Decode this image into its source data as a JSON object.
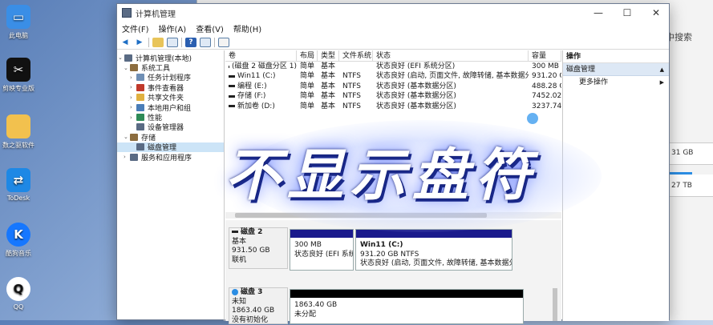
{
  "desktop": {
    "icons": [
      {
        "label": "此电脑",
        "icon": "monitor-icon",
        "color": "#3a8ee6"
      },
      {
        "label": "剪映专业版",
        "icon": "capcut-icon",
        "color": "#111111"
      },
      {
        "label": "数之驱软件",
        "icon": "folder-icon",
        "color": "#f2c14e"
      },
      {
        "label": "ToDesk",
        "icon": "todesk-icon",
        "color": "#1e88e5"
      },
      {
        "label": "酷狗音乐",
        "icon": "kugou-icon",
        "color": "#1677ff"
      },
      {
        "label": "QQ",
        "icon": "qq-icon",
        "color": "#ffffff"
      }
    ]
  },
  "back_window": {
    "search_text": "中搜索",
    "rows": [
      "31 GB",
      "27 TB"
    ]
  },
  "window": {
    "title": "计算机管理",
    "controls": {
      "minimize": "—",
      "maximize": "☐",
      "close": "✕"
    },
    "menu": [
      "文件(F)",
      "操作(A)",
      "查看(V)",
      "帮助(H)"
    ]
  },
  "tree": [
    {
      "label": "计算机管理(本地)",
      "level": 0,
      "chevron": "⌄",
      "icon_color": "#5a6b84"
    },
    {
      "label": "系统工具",
      "level": 1,
      "chevron": "⌄",
      "icon_color": "#8c6d3f"
    },
    {
      "label": "任务计划程序",
      "level": 2,
      "chevron": "›",
      "icon_color": "#6f8fb5"
    },
    {
      "label": "事件查看器",
      "level": 2,
      "chevron": "›",
      "icon_color": "#c0392b"
    },
    {
      "label": "共享文件夹",
      "level": 2,
      "chevron": "›",
      "icon_color": "#e0b040"
    },
    {
      "label": "本地用户和组",
      "level": 2,
      "chevron": "›",
      "icon_color": "#4a7db8"
    },
    {
      "label": "性能",
      "level": 2,
      "chevron": "›",
      "icon_color": "#2e8b57"
    },
    {
      "label": "设备管理器",
      "level": 2,
      "chevron": "",
      "icon_color": "#5a6b84"
    },
    {
      "label": "存储",
      "level": 1,
      "chevron": "⌄",
      "icon_color": "#8c6d3f"
    },
    {
      "label": "磁盘管理",
      "level": 2,
      "chevron": "",
      "icon_color": "#5a6b84",
      "selected": true
    },
    {
      "label": "服务和应用程序",
      "level": 1,
      "chevron": "›",
      "icon_color": "#5a6b84"
    }
  ],
  "volumes": {
    "headers": [
      "卷",
      "布局",
      "类型",
      "文件系统",
      "状态",
      "容量"
    ],
    "rows": [
      [
        "(磁盘 2 磁盘分区 1)",
        "简单",
        "基本",
        "",
        "状态良好 (EFI 系统分区)",
        "300 MB"
      ],
      [
        "Win11 (C:)",
        "简单",
        "基本",
        "NTFS",
        "状态良好 (启动, 页面文件, 故障转储, 基本数据分区)",
        "931.20 G"
      ],
      [
        "编程 (E:)",
        "简单",
        "基本",
        "NTFS",
        "状态良好 (基本数据分区)",
        "488.28 G"
      ],
      [
        "存储 (F:)",
        "简单",
        "基本",
        "NTFS",
        "状态良好 (基本数据分区)",
        "7452.02"
      ],
      [
        "新加卷 (D:)",
        "简单",
        "基本",
        "NTFS",
        "状态良好 (基本数据分区)",
        "3237.74"
      ]
    ]
  },
  "actions": {
    "header": "操作",
    "section": "磁盘管理",
    "more": "更多操作"
  },
  "disks": [
    {
      "name": "磁盘 2",
      "lines": [
        "基本",
        "931.50 GB",
        "联机"
      ],
      "partitions": [
        {
          "title": "",
          "size": "300 MB",
          "status": "状态良好 (EFI 系统分",
          "cap_color": "#1a1a8c"
        },
        {
          "title": "Win11  (C:)",
          "size": "931.20 GB NTFS",
          "status": "状态良好 (启动, 页面文件, 故障转储, 基本数据分区)",
          "cap_color": "#1a1a8c"
        }
      ]
    },
    {
      "name": "磁盘 3",
      "lines": [
        "未知",
        "1863.40 GB",
        "没有初始化"
      ],
      "partitions": [
        {
          "title": "",
          "size": "1863.40 GB",
          "status": "未分配",
          "cap_color": "#000000"
        }
      ]
    }
  ],
  "overlay_text": "不显示盘符"
}
